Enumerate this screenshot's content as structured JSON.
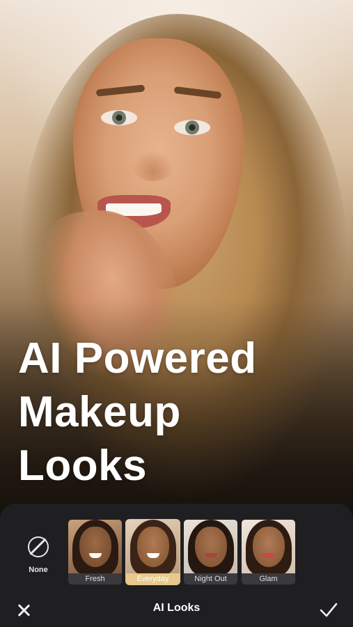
{
  "hero": {
    "headline_lines": [
      "AI Powered",
      "Makeup",
      "Looks"
    ]
  },
  "looks_panel": {
    "none_label": "None",
    "none_icon": "prohibited-icon",
    "items": [
      {
        "label": "Fresh",
        "selected": false
      },
      {
        "label": "Everyday",
        "selected": true
      },
      {
        "label": "Night Out",
        "selected": false
      },
      {
        "label": "Glam",
        "selected": false
      }
    ]
  },
  "bottom_bar": {
    "title": "AI Looks",
    "close_icon": "close-icon",
    "confirm_icon": "checkmark-icon"
  },
  "colors": {
    "panel_bg": "#1f1f22",
    "selected_accent": "#e7c98a",
    "text": "#ffffff"
  }
}
